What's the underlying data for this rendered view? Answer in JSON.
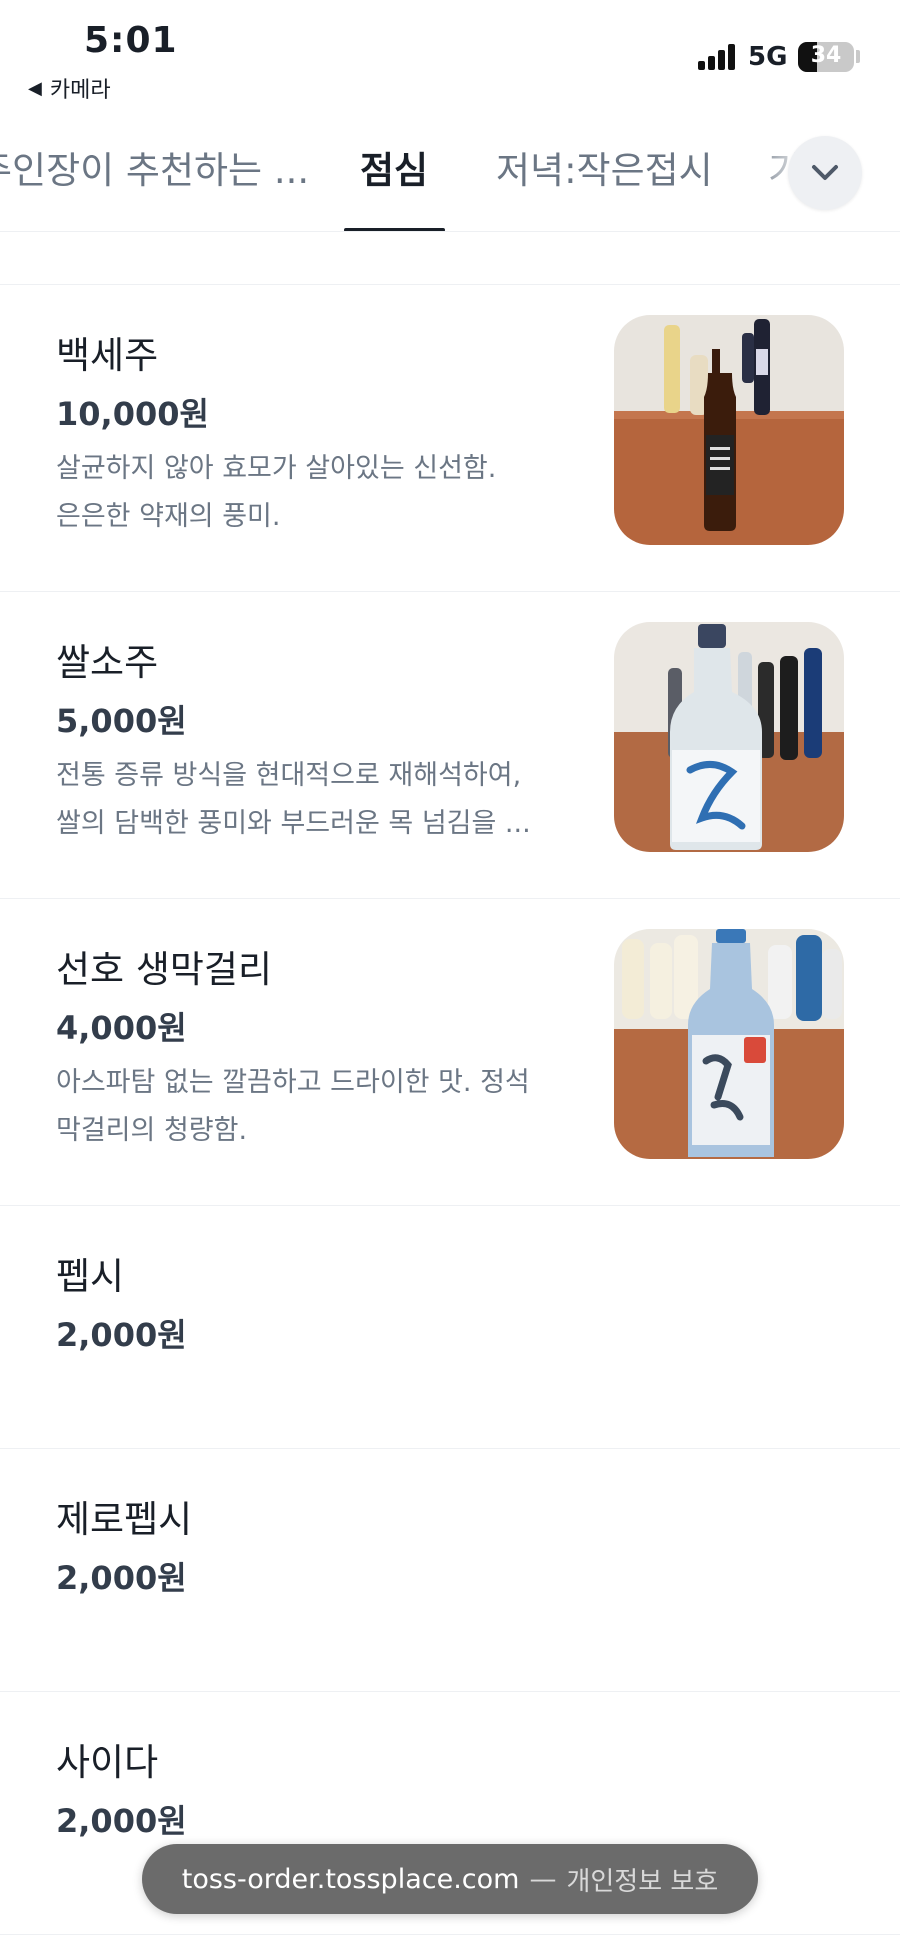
{
  "status_bar": {
    "time": "5:01",
    "back_app": "카메라",
    "network": "5G",
    "battery": 34
  },
  "tabs": [
    {
      "label": "주인장이 추천하는 ...",
      "active": false
    },
    {
      "label": "점심",
      "active": true
    },
    {
      "label": "저녁:작은접시",
      "active": false
    },
    {
      "label": "기",
      "active": false
    }
  ],
  "menu": [
    {
      "name": "백세주",
      "price": "10,000원",
      "desc": [
        "살균하지 않아 효모가 살아있는 신선함.",
        "은은한 약재의 풍미."
      ],
      "image": "baekseju-bottle-photo"
    },
    {
      "name": "쌀소주",
      "price": "5,000원",
      "desc": [
        "전통 증류 방식을 현대적으로 재해석하여,",
        "쌀의 담백한 풍미와 부드러운 목 넘김을 ..."
      ],
      "image": "rice-soju-bottle-photo"
    },
    {
      "name": "선호 생막걸리",
      "price": "4,000원",
      "desc": [
        "아스파탐 없는 깔끔하고 드라이한 맛. 정석",
        "막걸리의 청량함."
      ],
      "image": "seonho-makgeolli-bottle-photo"
    },
    {
      "name": "펩시",
      "price": "2,000원",
      "desc": []
    },
    {
      "name": "제로펩시",
      "price": "2,000원",
      "desc": []
    },
    {
      "name": "사이다",
      "price": "2,000원",
      "desc": []
    }
  ],
  "url_bar": {
    "host": "toss-order.tossplace.com",
    "separator": "—",
    "privacy": "개인정보 보호"
  },
  "icons": {
    "expand": "chevron-down-icon",
    "back": "back-triangle-icon",
    "signal": "cellular-signal-icon",
    "battery": "battery-icon"
  }
}
